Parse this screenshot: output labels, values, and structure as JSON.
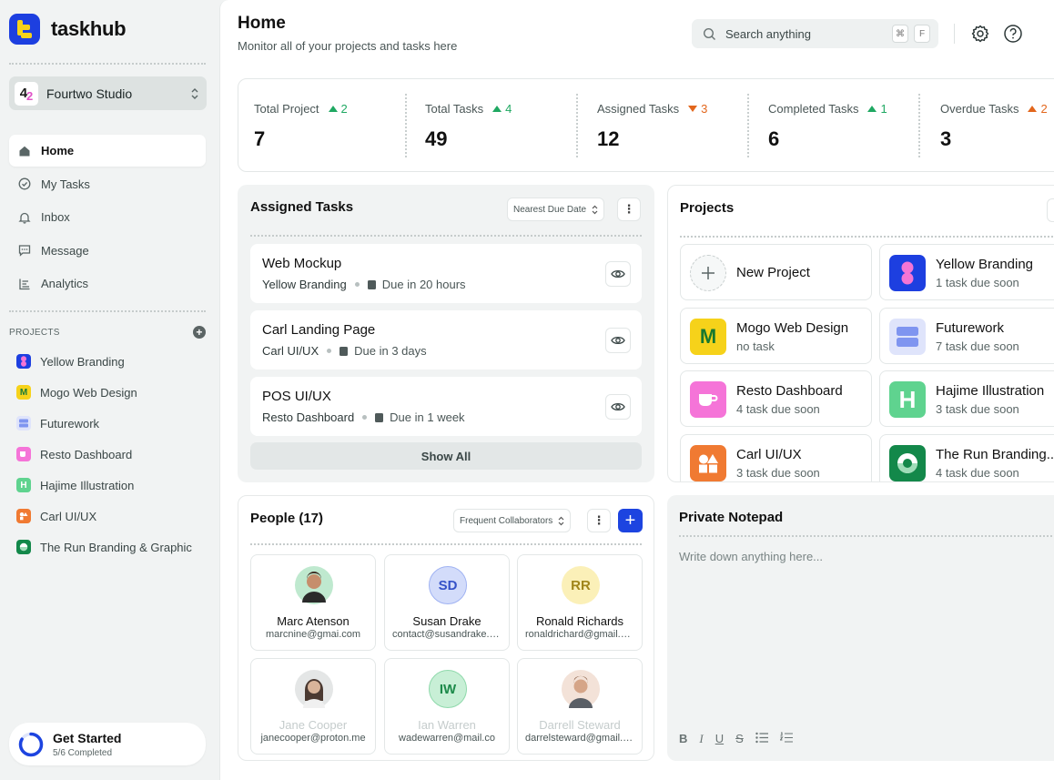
{
  "app": {
    "name": "taskhub"
  },
  "workspace": {
    "name": "Fourtwo Studio",
    "logo_a": "4",
    "logo_b": "2"
  },
  "nav": [
    {
      "label": "Home",
      "icon": "home-icon"
    },
    {
      "label": "My Tasks",
      "icon": "check-circle-icon"
    },
    {
      "label": "Inbox",
      "icon": "bell-icon"
    },
    {
      "label": "Message",
      "icon": "chat-icon"
    },
    {
      "label": "Analytics",
      "icon": "chart-icon"
    }
  ],
  "sidebar_projects": {
    "heading": "PROJECTS",
    "items": [
      {
        "label": "Yellow Branding",
        "color": "#1d3fe0"
      },
      {
        "label": "Mogo Web Design",
        "color": "#f6d21a"
      },
      {
        "label": "Futurework",
        "color": "#aab8f5"
      },
      {
        "label": "Resto Dashboard",
        "color": "#f277d6"
      },
      {
        "label": "Hajime Illustration",
        "color": "#5fd38f"
      },
      {
        "label": "Carl UI/UX",
        "color": "#f07a32"
      },
      {
        "label": "The Run Branding & Graphic",
        "color": "#13884a"
      }
    ]
  },
  "get_started": {
    "title": "Get Started",
    "subtitle": "5/6 Completed",
    "progress": 0.83
  },
  "header": {
    "title": "Home",
    "subtitle": "Monitor all of your projects and tasks here"
  },
  "search": {
    "placeholder": "Search anything",
    "key1": "⌘",
    "key2": "F"
  },
  "stats": [
    {
      "label": "Total Project",
      "value": "7",
      "trend": "2",
      "dir": "up"
    },
    {
      "label": "Total Tasks",
      "value": "49",
      "trend": "4",
      "dir": "up"
    },
    {
      "label": "Assigned Tasks",
      "value": "12",
      "trend": "3",
      "dir": "down"
    },
    {
      "label": "Completed Tasks",
      "value": "6",
      "trend": "1",
      "dir": "up"
    },
    {
      "label": "Overdue Tasks",
      "value": "3",
      "trend": "2",
      "dir": "up"
    }
  ],
  "assigned": {
    "title": "Assigned Tasks",
    "sort": "Nearest Due Date",
    "tasks": [
      {
        "title": "Web Mockup",
        "project": "Yellow Branding",
        "due": "Due in 20 hours"
      },
      {
        "title": "Carl Landing Page",
        "project": "Carl UI/UX",
        "due": "Due in 3 days"
      },
      {
        "title": "POS UI/UX",
        "project": "Resto Dashboard",
        "due": "Due in 1 week"
      }
    ],
    "show_all": "Show All"
  },
  "projects": {
    "title": "Projects",
    "new_label": "New Project",
    "cards": [
      {
        "name": "Yellow Branding",
        "sub": "1 task due soon",
        "bg": "#1d3fe0"
      },
      {
        "name": "Mogo Web Design",
        "sub": "no task",
        "bg": "#f6d21a",
        "glyph": "M"
      },
      {
        "name": "Futurework",
        "sub": "7 task due soon",
        "bg": "#dfe4fb"
      },
      {
        "name": "Resto Dashboard",
        "sub": "4 task due soon",
        "bg": "#f574d8"
      },
      {
        "name": "Hajime Illustration",
        "sub": "3 task due soon",
        "bg": "#5fd38f",
        "glyph": "H"
      },
      {
        "name": "Carl UI/UX",
        "sub": "3 task due soon",
        "bg": "#f07a32"
      },
      {
        "name": "The Run Branding...",
        "sub": "4 task due soon",
        "bg": "#13884a"
      }
    ]
  },
  "people": {
    "title": "People (17)",
    "filter": "Frequent Collaborators",
    "list": [
      {
        "name": "Marc Atenson",
        "email": "marcnine@gmai.com",
        "avatar_bg": "#bfe9cf"
      },
      {
        "name": "Susan Drake",
        "email": "contact@susandrake.com",
        "initials": "SD",
        "avatar_bg": "#d3dcfa",
        "initials_color": "#3552c8"
      },
      {
        "name": "Ronald Richards",
        "email": "ronaldrichard@gmail.com",
        "initials": "RR",
        "avatar_bg": "#fbf0b8",
        "initials_color": "#a0851a"
      },
      {
        "name": "Jane Cooper",
        "email": "janecooper@proton.me",
        "avatar_bg": "#e4e6e6"
      },
      {
        "name": "Ian Warren",
        "email": "wadewarren@mail.co",
        "initials": "IW",
        "avatar_bg": "#c8efd6",
        "initials_color": "#1d8a4a"
      },
      {
        "name": "Darrell Steward",
        "email": "darrelsteward@gmail.com",
        "avatar_bg": "#f3e2d8"
      }
    ]
  },
  "notepad": {
    "title": "Private Notepad",
    "placeholder": "Write down anything here...",
    "tools": [
      "B",
      "I",
      "U",
      "S"
    ]
  }
}
